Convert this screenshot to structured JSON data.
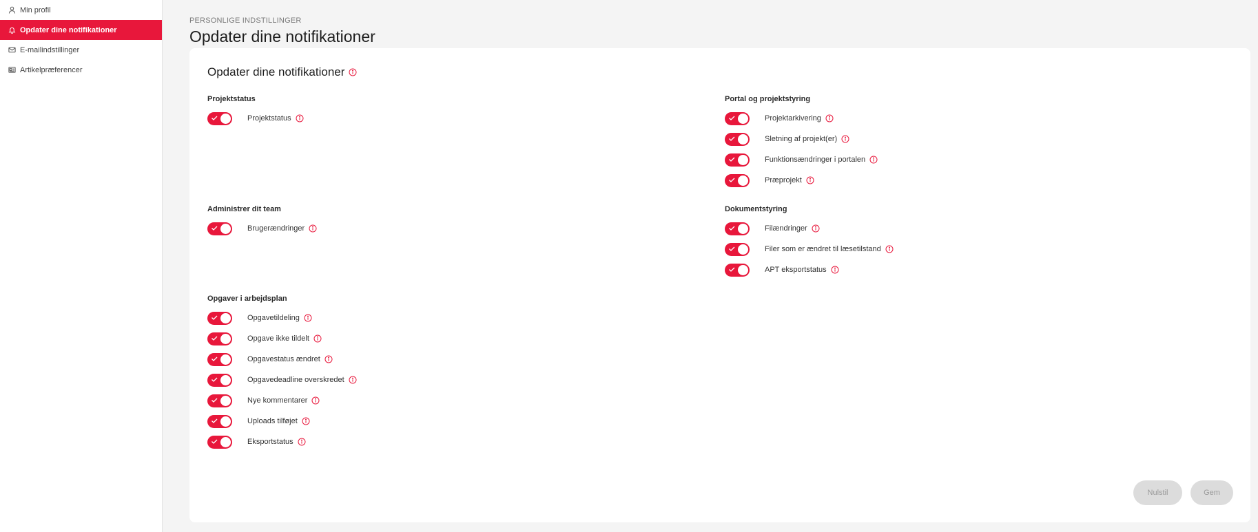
{
  "sidebar": {
    "items": [
      {
        "label": "Min profil",
        "icon": "user-icon"
      },
      {
        "label": "Opdater dine notifikationer",
        "icon": "bell-icon",
        "active": true
      },
      {
        "label": "E-mailindstillinger",
        "icon": "envelope-icon"
      },
      {
        "label": "Artikelpræferencer",
        "icon": "article-icon"
      }
    ]
  },
  "header": {
    "breadcrumb": "PERSONLIGE INDSTILLINGER",
    "title": "Opdater dine notifikationer"
  },
  "card": {
    "title": "Opdater dine notifikationer"
  },
  "sections": {
    "projektstatus": {
      "title": "Projektstatus",
      "items": [
        {
          "label": "Projektstatus",
          "enabled": true
        }
      ]
    },
    "portal": {
      "title": "Portal og projektstyring",
      "items": [
        {
          "label": "Projektarkivering",
          "enabled": true
        },
        {
          "label": "Sletning af projekt(er)",
          "enabled": true
        },
        {
          "label": "Funktionsændringer i portalen",
          "enabled": true
        },
        {
          "label": "Præprojekt",
          "enabled": true
        }
      ]
    },
    "team": {
      "title": "Administrer dit team",
      "items": [
        {
          "label": "Brugerændringer",
          "enabled": true
        }
      ]
    },
    "dokument": {
      "title": "Dokumentstyring",
      "items": [
        {
          "label": "Filændringer",
          "enabled": true
        },
        {
          "label": "Filer som er ændret til læsetilstand",
          "enabled": true
        },
        {
          "label": "APT eksportstatus",
          "enabled": true
        }
      ]
    },
    "opgaver": {
      "title": "Opgaver i arbejdsplan",
      "items": [
        {
          "label": "Opgavetildeling",
          "enabled": true
        },
        {
          "label": "Opgave ikke tildelt",
          "enabled": true
        },
        {
          "label": "Opgavestatus ændret",
          "enabled": true
        },
        {
          "label": "Opgavedeadline overskredet",
          "enabled": true
        },
        {
          "label": "Nye kommentarer",
          "enabled": true
        },
        {
          "label": "Uploads tilføjet",
          "enabled": true
        },
        {
          "label": "Eksportstatus",
          "enabled": true
        }
      ]
    }
  },
  "buttons": {
    "reset": "Nulstil",
    "save": "Gem"
  },
  "colors": {
    "accent": "#e8173b",
    "background": "#f4f4f4",
    "button_disabled": "#dcdcdc"
  }
}
